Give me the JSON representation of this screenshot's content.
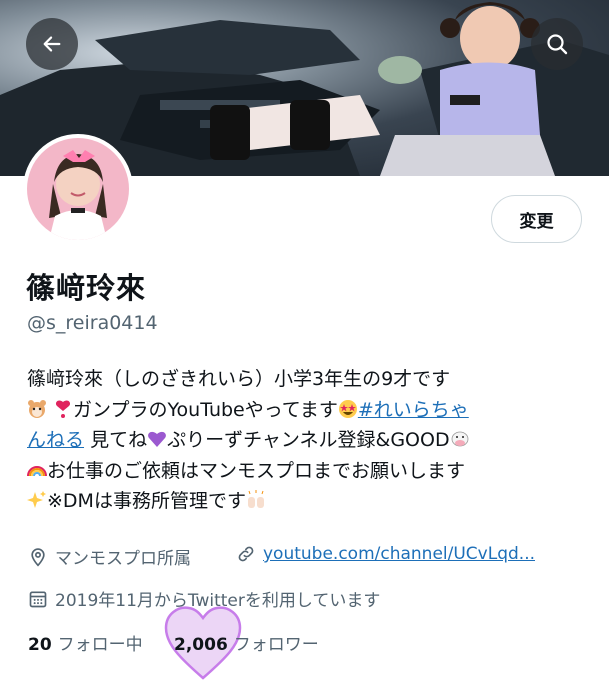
{
  "header": {
    "back_icon": "arrow-left-icon",
    "search_icon": "search-icon"
  },
  "profile": {
    "name": "篠﨑玲來",
    "handle": "@s_reira0414",
    "edit_label": "変更"
  },
  "bio": {
    "line1": "篠﨑玲來（しのざきれいら）小学3年生の9才です",
    "line2_text": "ガンプラのYouTubeやってます",
    "hashtag_part1": "#れいらちゃ",
    "hashtag_part2": "んねる",
    "line3_text": "見てね",
    "line3_text2": "ぷりーずチャンネル登録&GOOD",
    "line4_text": "お仕事のご依頼はマンモスプロまでお願いします",
    "line5_text": "※DMは事務所管理です"
  },
  "meta": {
    "location": "マンモスプロ所属",
    "website": "youtube.com/channel/UCvLqd...",
    "joined": "2019年11月からTwitterを利用しています"
  },
  "stats": {
    "following_count": "20",
    "following_label": "フォロー中",
    "followers_count": "2,006",
    "followers_label": "フォロワー"
  },
  "colors": {
    "link": "#1d6fb8",
    "secondary_text": "#536471",
    "heart_annotation": "#c77dea"
  }
}
